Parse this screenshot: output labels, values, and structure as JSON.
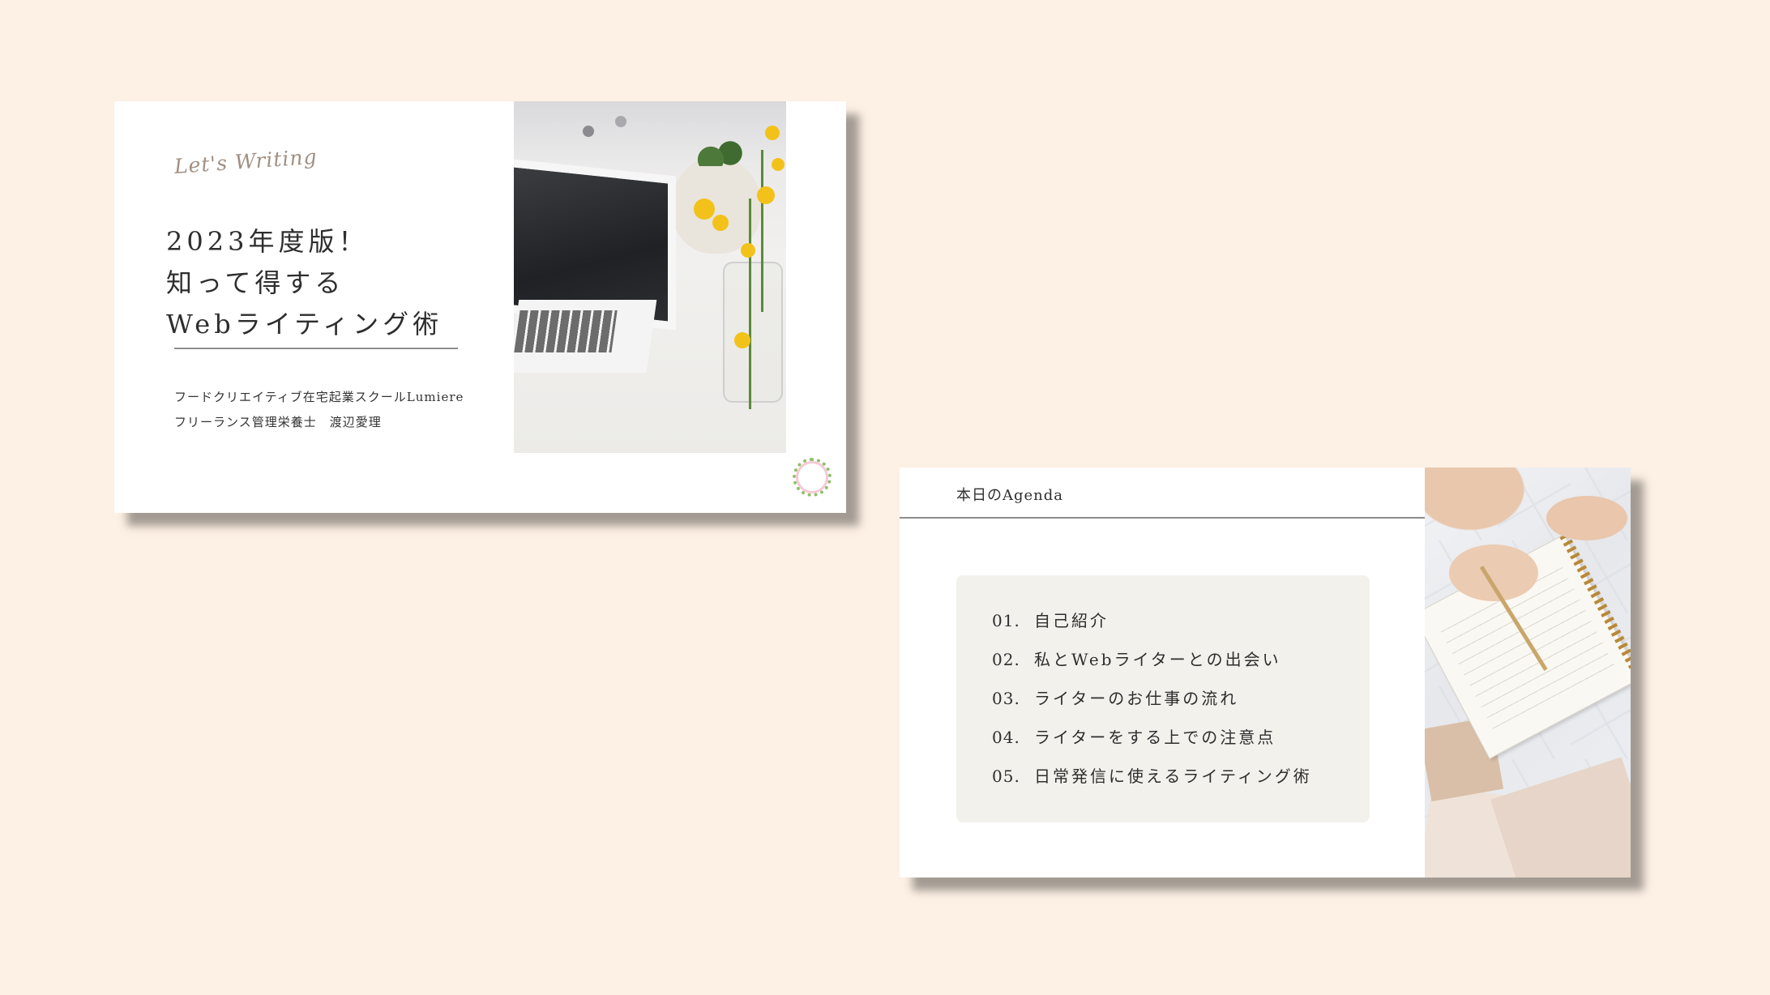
{
  "slide_title": {
    "script_tag": "Let's Writing",
    "title_lines": [
      "2023年度版！",
      "知って得する",
      "Webライティング術"
    ],
    "subtitle_lines": [
      "フードクリエイティブ在宅起業スクールLumiere",
      "フリーランス管理栄養士　渡辺愛理"
    ]
  },
  "slide_agenda": {
    "title": "本日のAgenda",
    "items": [
      {
        "num": "01.",
        "label": "自己紹介"
      },
      {
        "num": "02.",
        "label": "私とWebライターとの出会い"
      },
      {
        "num": "03.",
        "label": "ライターのお仕事の流れ"
      },
      {
        "num": "04.",
        "label": "ライターをする上での注意点"
      },
      {
        "num": "05.",
        "label": "日常発信に使えるライティング術"
      }
    ]
  }
}
